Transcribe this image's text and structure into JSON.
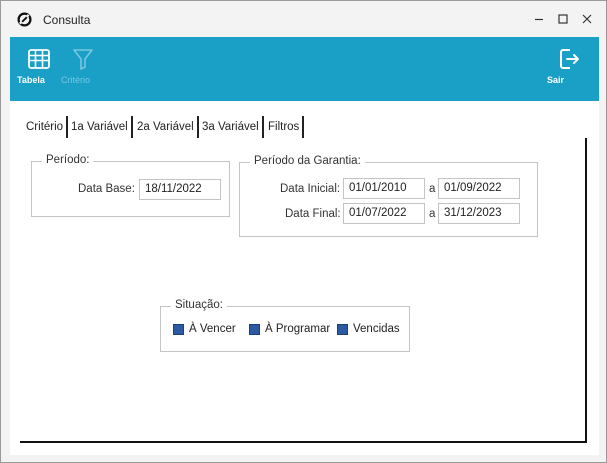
{
  "window": {
    "title": "Consulta",
    "icon": "circular-arrows-icon"
  },
  "toolbar": {
    "tabela_label": "Tabela",
    "criterio_label": "Critério",
    "sair_label": "Sair"
  },
  "tabs": [
    {
      "label": "Critério"
    },
    {
      "label": "1a Variável"
    },
    {
      "label": "2a Variável"
    },
    {
      "label": "3a Variável"
    },
    {
      "label": "Filtros"
    }
  ],
  "periodo": {
    "legend": "Período:",
    "data_base_label": "Data Base:",
    "data_base_value": "18/11/2022"
  },
  "garantia": {
    "legend": "Período da Garantia:",
    "data_inicial_label": "Data Inicial:",
    "data_inicial_from": "01/01/2010",
    "data_inicial_to": "01/09/2022",
    "data_final_label": "Data Final:",
    "data_final_from": "01/07/2022",
    "data_final_to": "31/12/2023",
    "range_sep": "a"
  },
  "situacao": {
    "legend": "Situação:",
    "options": [
      {
        "label": "À Vencer",
        "checked": true
      },
      {
        "label": "À Programar",
        "checked": true
      },
      {
        "label": "Vencidas",
        "checked": true
      }
    ]
  }
}
